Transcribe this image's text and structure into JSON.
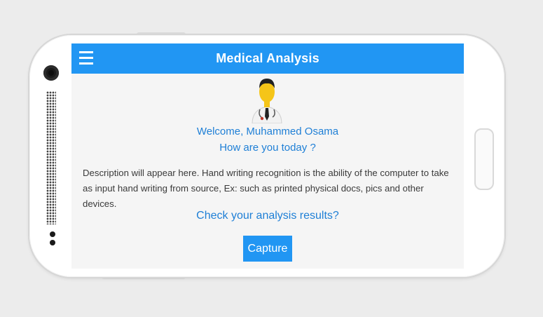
{
  "appbar": {
    "title": "Medical Analysis",
    "menu_icon": "hamburger-menu-icon"
  },
  "profile": {
    "avatar_icon": "doctor-avatar-icon",
    "welcome_line": "Welcome, Muhammed Osama",
    "greeting_line": "How are you today ?"
  },
  "main": {
    "description": "Description will appear here. Hand writing recognition is the ability of the computer to take as input hand writing from source, Ex: such as printed physical docs, pics and other devices.",
    "check_link": "Check your analysis results?",
    "capture_label": "Capture"
  },
  "colors": {
    "primary": "#2196f3",
    "link_text": "#1e7fd6",
    "body_text": "#3a3a3a",
    "screen_bg": "#f5f5f5"
  }
}
